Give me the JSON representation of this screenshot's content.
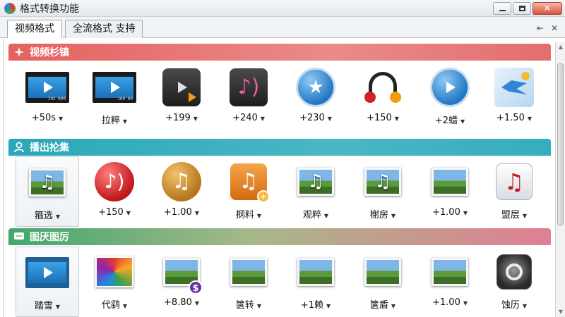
{
  "window": {
    "title": "格式转换功能",
    "close_glyph": "✕"
  },
  "tabs": [
    {
      "label": "视频格式",
      "active": true
    },
    {
      "label": "全流格式 支持",
      "active": false
    }
  ],
  "tab_controls": {
    "pin": "⇤",
    "close": "✕"
  },
  "sections": [
    {
      "title": "视频杉镇",
      "icon": "sparkle-icon",
      "color": "#e4625f",
      "items": [
        {
          "label": "+50s",
          "icon": "film-video-icon",
          "film_text": "102 600"
        },
        {
          "label": "拉粹",
          "icon": "film-video-icon",
          "film_text": "160 00"
        },
        {
          "label": "+199",
          "icon": "media-player-icon"
        },
        {
          "label": "+240",
          "icon": "music-waves-icon"
        },
        {
          "label": "+230",
          "icon": "star-badge-icon"
        },
        {
          "label": "+150",
          "icon": "headphones-icon"
        },
        {
          "label": "+2蜡",
          "icon": "play-circle-icon"
        },
        {
          "label": "+1.50",
          "icon": "bird-icon"
        }
      ]
    },
    {
      "title": "播出抡集",
      "icon": "audio-person-icon",
      "color": "#2aa7b8",
      "items": [
        {
          "label": "箍选",
          "icon": "music-photo-icon",
          "selected": true
        },
        {
          "label": "+150",
          "icon": "music-red-circle-icon"
        },
        {
          "label": "+1.00",
          "icon": "music-gold-circle-icon"
        },
        {
          "label": "㧏料",
          "icon": "music-orange-plus-icon"
        },
        {
          "label": "观粹",
          "icon": "music-landscape-icon"
        },
        {
          "label": "榭房",
          "icon": "music-landscape-icon"
        },
        {
          "label": "+1.00",
          "icon": "photo-stack-icon"
        },
        {
          "label": "盟层",
          "icon": "music-note-tile-icon"
        }
      ]
    },
    {
      "title": "图厌图厉",
      "icon": "image-chat-icon",
      "color": "#3fa96c",
      "items": [
        {
          "label": "踏雪",
          "icon": "play-square-icon",
          "selected": true
        },
        {
          "label": "代鹞",
          "icon": "colorful-photo-icon"
        },
        {
          "label": "+8.80",
          "icon": "photo-dollar-icon"
        },
        {
          "label": "箧转",
          "icon": "landscape-photo-icon"
        },
        {
          "label": "+1赖",
          "icon": "landscape-photo-icon"
        },
        {
          "label": "箧盾",
          "icon": "landscape-photo-icon"
        },
        {
          "label": "+1.00",
          "icon": "landscape-photo-icon"
        },
        {
          "label": "蚀历",
          "icon": "speaker-icon"
        }
      ]
    }
  ]
}
